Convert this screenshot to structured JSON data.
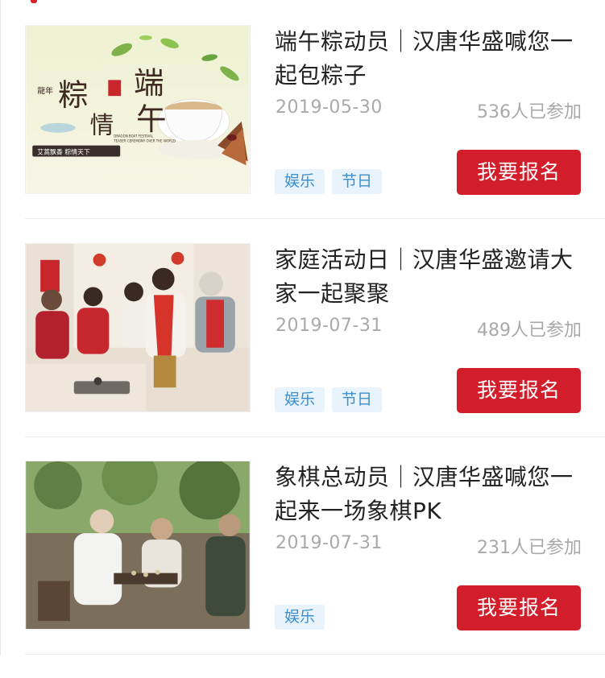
{
  "activities": [
    {
      "title": "端午粽动员｜汉唐华盛喊您一起包粽子",
      "date": "2019-05-30",
      "participants": "536人已参加",
      "tags": [
        "娱乐",
        "节日"
      ],
      "signup_label": "我要报名",
      "image_text": {
        "big1": "粽",
        "big2": "情",
        "big3": "端",
        "big4": "午",
        "small": "龍年",
        "en1": "DRAGON BOAT FESTIVAL",
        "en2": "TEASER CEREMONY OVER THE WORLD",
        "slogan": "艾蒿飘香 粽情天下"
      }
    },
    {
      "title": "家庭活动日｜汉唐华盛邀请大家一起聚聚",
      "date": "2019-07-31",
      "participants": "489人已参加",
      "tags": [
        "娱乐",
        "节日"
      ],
      "signup_label": "我要报名"
    },
    {
      "title": "象棋总动员｜汉唐华盛喊您一起来一场象棋PK",
      "date": "2019-07-31",
      "participants": "231人已参加",
      "tags": [
        "娱乐"
      ],
      "signup_label": "我要报名"
    }
  ]
}
